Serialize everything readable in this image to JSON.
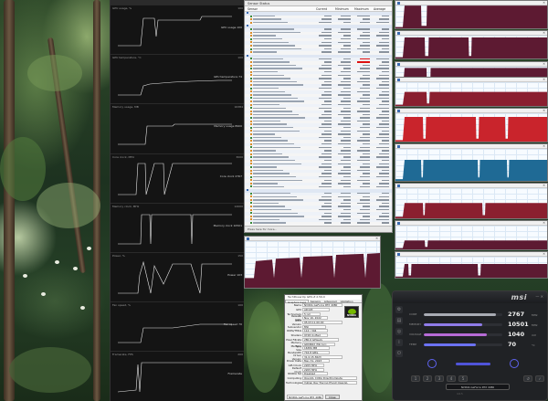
{
  "colors": {
    "hwinfo_header": "#dfe7f3",
    "gw_red": "#c9242c",
    "gw_maroon": "#8a1f2f",
    "gw_blue": "#1f6a95",
    "gw_dark": "#5d1a32",
    "msi_accent": "#5e63f0"
  },
  "afterburner_graphs": [
    {
      "head": "GPU usage, %",
      "max": "100",
      "name": "GPU usage 100"
    },
    {
      "head": "GPU temperature, °C",
      "max": "100",
      "name": "GPU temperature 74"
    },
    {
      "head": "Memory usage, MB",
      "max": "16384",
      "name": "Memory usage 8900"
    },
    {
      "head": "Core clock, MHz",
      "max": "3000",
      "name": "Core clock 2767"
    },
    {
      "head": "Memory clock, MHz",
      "max": "12000",
      "name": "Memory clock 10501"
    },
    {
      "head": "Power, %",
      "max": "150",
      "name": "Power 103"
    },
    {
      "head": "Fan speed, %",
      "max": "100",
      "name": "Fan speed 70"
    },
    {
      "head": "Framerate, FPS",
      "max": "200",
      "name": "Framerate"
    }
  ],
  "hwinfo": {
    "title": "Sensor Status",
    "columns": [
      "Sensor",
      "Current",
      "Minimum",
      "Maximum",
      "Average"
    ],
    "status": "Press here for more..."
  },
  "gpuz": {
    "title": "TechPowerUp GPU-Z 2.59.0",
    "tabs": [
      "Graphics Card",
      "Sensors",
      "Advanced",
      "Validation"
    ],
    "rows": [
      {
        "label": "Name",
        "value": "NVIDIA GeForce RTX 4080"
      },
      {
        "label": "GPU",
        "value": "AD103"
      },
      {
        "label": "Technology",
        "value": "5 nm"
      },
      {
        "label": "Release Date",
        "value": "Nov 16, 2022"
      },
      {
        "label": "BIOS Version",
        "value": "95.03.11.00.00"
      },
      {
        "label": "Subvendor",
        "value": "MSI"
      },
      {
        "label": "ROPs/TMUs",
        "value": "112 / 304"
      },
      {
        "label": "Shaders",
        "value": "9728 Unified"
      },
      {
        "label": "Pixel Fillrate",
        "value": "280.6 GPixel/s"
      },
      {
        "label": "Memory Type",
        "value": "GDDR6X (Micron)"
      },
      {
        "label": "Memory Size",
        "value": "16384 MB"
      },
      {
        "label": "Bandwidth",
        "value": "716.8 GB/s"
      },
      {
        "label": "Driver Version",
        "value": "31.0.15.3623"
      },
      {
        "label": "Driver Date",
        "value": "May 31, 2023"
      },
      {
        "label": "GPU Clock",
        "value": "2205 MHz"
      },
      {
        "label": "Default Clock",
        "value": "2205 MHz"
      },
      {
        "label": "NVIDIA SLI",
        "value": "Disabled"
      },
      {
        "label": "Computing",
        "value": "OpenCL CUDA DirectCompute"
      },
      {
        "label": "Technologies",
        "value": "Vulkan Ray Tracing PhysX OpenGL"
      }
    ],
    "device_select": "NVIDIA GeForce RTX 4080",
    "close_label": "Close",
    "logo_text": "NVIDIA"
  },
  "msi": {
    "logo": "msi",
    "window_controls": "— ✕",
    "rows": [
      {
        "label": "CORE",
        "value": "2767",
        "unit": "MHz",
        "fill": 0.92,
        "color": "#a8abb3"
      },
      {
        "label": "MEMORY",
        "value": "10501",
        "unit": "MHz",
        "fill": 0.74,
        "color": "#8f7ce8"
      },
      {
        "label": "VOLTAGE",
        "value": "1040",
        "unit": "mV",
        "fill": 0.8,
        "color": "#b66bd6"
      },
      {
        "label": "TEMP",
        "value": "70",
        "unit": "°C",
        "fill": 0.66,
        "color": "#6c72f2"
      }
    ],
    "gpu_name": "NVIDIA GeForce RTX 4080",
    "version": "4.6.5"
  }
}
